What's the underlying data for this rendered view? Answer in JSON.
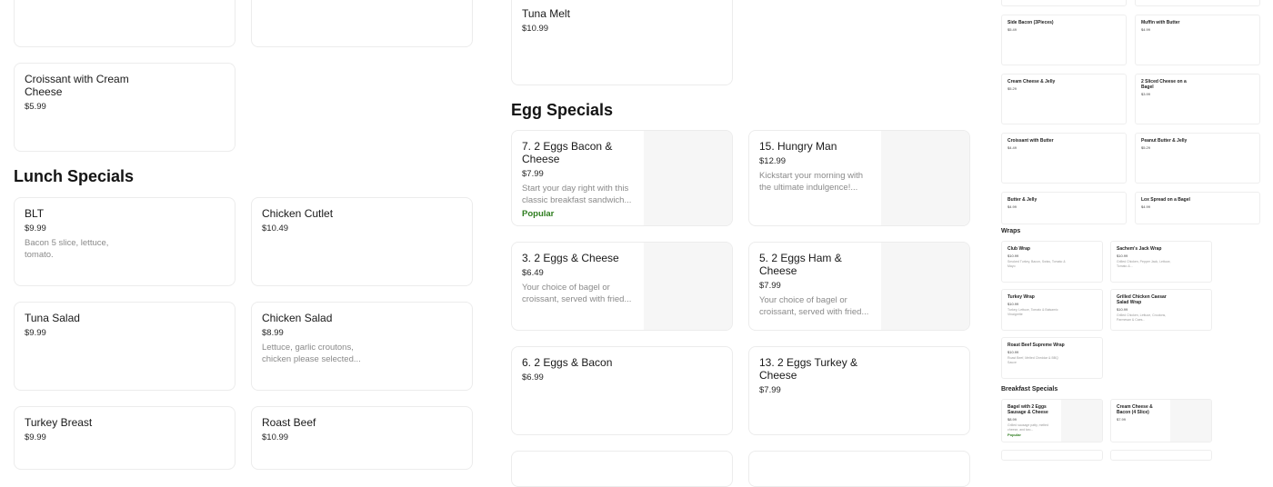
{
  "column1": {
    "top_cards": [
      "",
      ""
    ],
    "croissant_cream": {
      "name": "Croissant with Cream Cheese",
      "price": "$5.99"
    },
    "lunch_heading": "Lunch Specials",
    "lunch_items": [
      {
        "name": "BLT",
        "price": "$9.99",
        "desc": "Bacon 5 slice, lettuce, tomato."
      },
      {
        "name": "Chicken Cutlet",
        "price": "$10.49",
        "desc": ""
      },
      {
        "name": "Tuna Salad",
        "price": "$9.99",
        "desc": ""
      },
      {
        "name": "Chicken Salad",
        "price": "$8.99",
        "desc": "Lettuce, garlic croutons, chicken please selected..."
      },
      {
        "name": "Turkey Breast",
        "price": "$9.99",
        "desc": ""
      },
      {
        "name": "Roast Beef",
        "price": "$10.99",
        "desc": ""
      }
    ]
  },
  "column2": {
    "tuna_melt": {
      "name": "Tuna Melt",
      "price": "$10.99"
    },
    "egg_heading": "Egg Specials",
    "egg_items": [
      {
        "name": "7. 2 Eggs Bacon & Cheese",
        "price": "$7.99",
        "desc": "Start your day right with this classic breakfast sandwich...",
        "badge": "Popular"
      },
      {
        "name": "15. Hungry Man",
        "price": "$12.99",
        "desc": "Kickstart your morning with the ultimate indulgence!...",
        "badge": ""
      },
      {
        "name": "3. 2 Eggs & Cheese",
        "price": "$6.49",
        "desc": "Your choice of bagel or croissant, served with fried...",
        "badge": ""
      },
      {
        "name": "5. 2 Eggs Ham & Cheese",
        "price": "$7.99",
        "desc": "Your choice of bagel or croissant, served with fried...",
        "badge": ""
      },
      {
        "name": "6. 2 Eggs & Bacon",
        "price": "$6.99",
        "desc": "",
        "badge": ""
      },
      {
        "name": "13. 2 Eggs Turkey & Cheese",
        "price": "$7.99",
        "desc": "",
        "badge": ""
      }
    ]
  },
  "minimap": {
    "top_items": [
      {
        "name": "Side Bacon (3Pieces)",
        "price": "$5.49"
      },
      {
        "name": "Muffin with Butter",
        "price": "$4.99"
      },
      {
        "name": "Cream Cheese & Jelly",
        "price": "$5.29"
      },
      {
        "name": "2 Sliced Cheese on a Bagel",
        "price": "$3.99"
      },
      {
        "name": "Croissant with Butter",
        "price": "$4.49"
      },
      {
        "name": "Peanut Butter & Jelly",
        "price": "$5.29"
      },
      {
        "name": "Butter & Jelly",
        "price": "$4.99"
      },
      {
        "name": "Lox Spread on a Bagel",
        "price": "$4.99"
      }
    ],
    "wraps_heading": "Wraps",
    "wraps": [
      {
        "name": "Club Wrap",
        "price": "$10.99",
        "desc": "Smoked Turkey, Bacon, Swiss, Tomato & Mayo"
      },
      {
        "name": "Sachem's Jack Wrap",
        "price": "$10.99",
        "desc": "Grilled Chicken, Pepper Jack, Lettuce, Tomato &..."
      },
      {
        "name": "Turkey Wrap",
        "price": "$10.99",
        "desc": "Turkey, Lettuce, Tomato & Balsamic Vinaigrette"
      },
      {
        "name": "Grilled Chicken Caesar Salad Wrap",
        "price": "$10.99",
        "desc": "Grilled Chicken, Lettuce, Croutons, Parmesan & Caes..."
      },
      {
        "name": "Roast Beef Supreme Wrap",
        "price": "$10.99",
        "desc": "Roast Beef, Melted Cheddar & BBQ Sauce"
      }
    ],
    "breakfast_heading": "Breakfast Specials",
    "breakfast": [
      {
        "name": "Bagel with 2 Eggs Sausage & Cheese",
        "price": "$8.99",
        "desc": "Grilled sausage patty, melted cheese, and two...",
        "badge": "Popular"
      },
      {
        "name": "Cream Cheese & Bacon (4 Slice)",
        "price": "$7.99",
        "desc": "",
        "badge": ""
      }
    ]
  }
}
